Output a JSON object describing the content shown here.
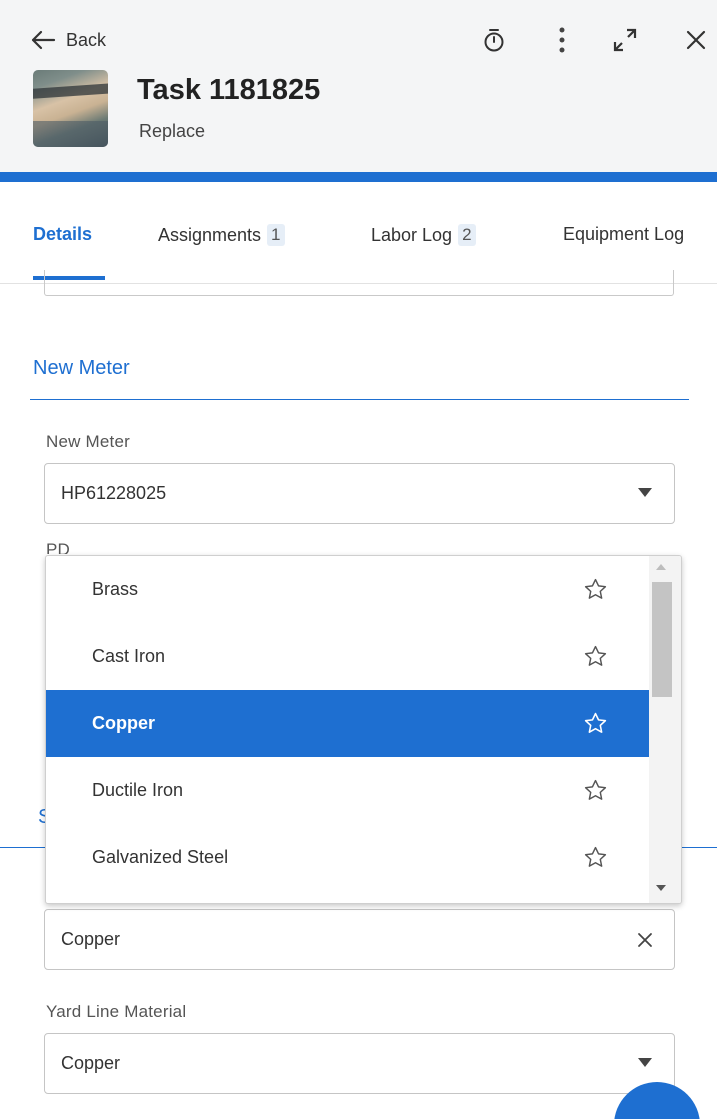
{
  "header": {
    "back_label": "Back",
    "title": "Task 1181825",
    "subtitle": "Replace",
    "icons": [
      "timer-icon",
      "more-vertical-icon",
      "expand-icon",
      "close-icon"
    ],
    "accent_color": "#1e6fd1"
  },
  "tabs": [
    {
      "label": "Details",
      "active": true
    },
    {
      "label": "Assignments",
      "count": "1"
    },
    {
      "label": "Labor Log",
      "count": "2"
    },
    {
      "label": "Equipment Log"
    }
  ],
  "section": {
    "title": "New Meter",
    "second_title_partial": "S"
  },
  "fields": {
    "new_meter": {
      "label": "New Meter",
      "value": "HP61228025"
    },
    "partial_label": "PD",
    "material_value": "Copper",
    "yard_line": {
      "label": "Yard Line Material",
      "value": "Copper"
    }
  },
  "dropdown": {
    "options": [
      {
        "label": "Brass"
      },
      {
        "label": "Cast Iron"
      },
      {
        "label": "Copper",
        "selected": true
      },
      {
        "label": "Ductile Iron"
      },
      {
        "label": "Galvanized Steel"
      }
    ]
  }
}
